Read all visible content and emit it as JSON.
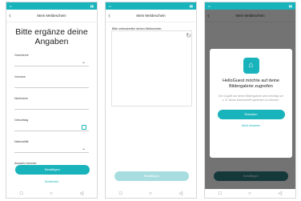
{
  "screen1": {
    "header_title": "Mein Meldeschein",
    "big_title_line1": "Bitte ergänze deine",
    "big_title_line2": "Angaben",
    "fields": [
      {
        "label": "Geschlecht"
      },
      {
        "label": "Vorname"
      },
      {
        "label": "Nachname"
      },
      {
        "label": "Geburtstag"
      },
      {
        "label": "Nationalität"
      },
      {
        "label": "Ausweis-Nummer"
      }
    ],
    "confirm_label": "Bestätigen",
    "skip_label": "Schließen"
  },
  "screen2": {
    "header_title": "Mein Meldeschein",
    "signature_label": "Bitte unterschreibe deinen Meldeschein:",
    "confirm_label": "Bestätigen"
  },
  "screen3": {
    "header_title": "Mein Meldeschein",
    "dialog_title": "HelloGuest möchte auf deine Bildergalerie zugreifen",
    "dialog_text": "Der Zugriff auf deine Bildergalerie wird benötigt um z. B. deine Unterschrift speichern zu können.",
    "allow_label": "Erlauben",
    "deny_label": "Nicht erlauben",
    "confirm_label": "Bestätigen"
  },
  "colors": {
    "accent": "#19b3bc"
  },
  "icons": [
    "back-arrow-icon",
    "chevron-down-icon",
    "calendar-icon",
    "refresh-icon",
    "app-logo-icon",
    "nav-back-icon",
    "nav-home-icon",
    "nav-recents-icon"
  ]
}
